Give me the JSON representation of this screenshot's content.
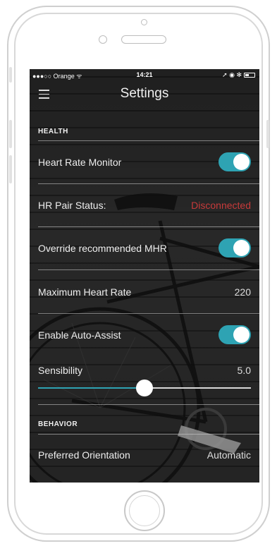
{
  "status_bar": {
    "carrier": "●●●○○ Orange ᯤ",
    "time": "14:21",
    "icons": "➚ ◉ ✻"
  },
  "nav": {
    "title": "Settings"
  },
  "health": {
    "header": "HEALTH",
    "heart_rate_monitor": {
      "label": "Heart Rate Monitor",
      "on": true
    },
    "hr_pair_status": {
      "label": "HR Pair Status:",
      "value": "Disconnected"
    },
    "override_mhr": {
      "label": "Override recommended MHR",
      "on": true
    },
    "max_heart_rate": {
      "label": "Maximum Heart Rate",
      "value": "220"
    },
    "auto_assist": {
      "label": "Enable Auto-Assist",
      "on": true
    },
    "sensibility": {
      "label": "Sensibility",
      "value": "5.0",
      "fraction": 0.5
    }
  },
  "behavior": {
    "header": "BEHAVIOR",
    "preferred_orientation": {
      "label": "Preferred Orientation",
      "value": "Automatic"
    }
  },
  "colors": {
    "accent": "#2ea3b3",
    "warning": "#c73a3a"
  }
}
